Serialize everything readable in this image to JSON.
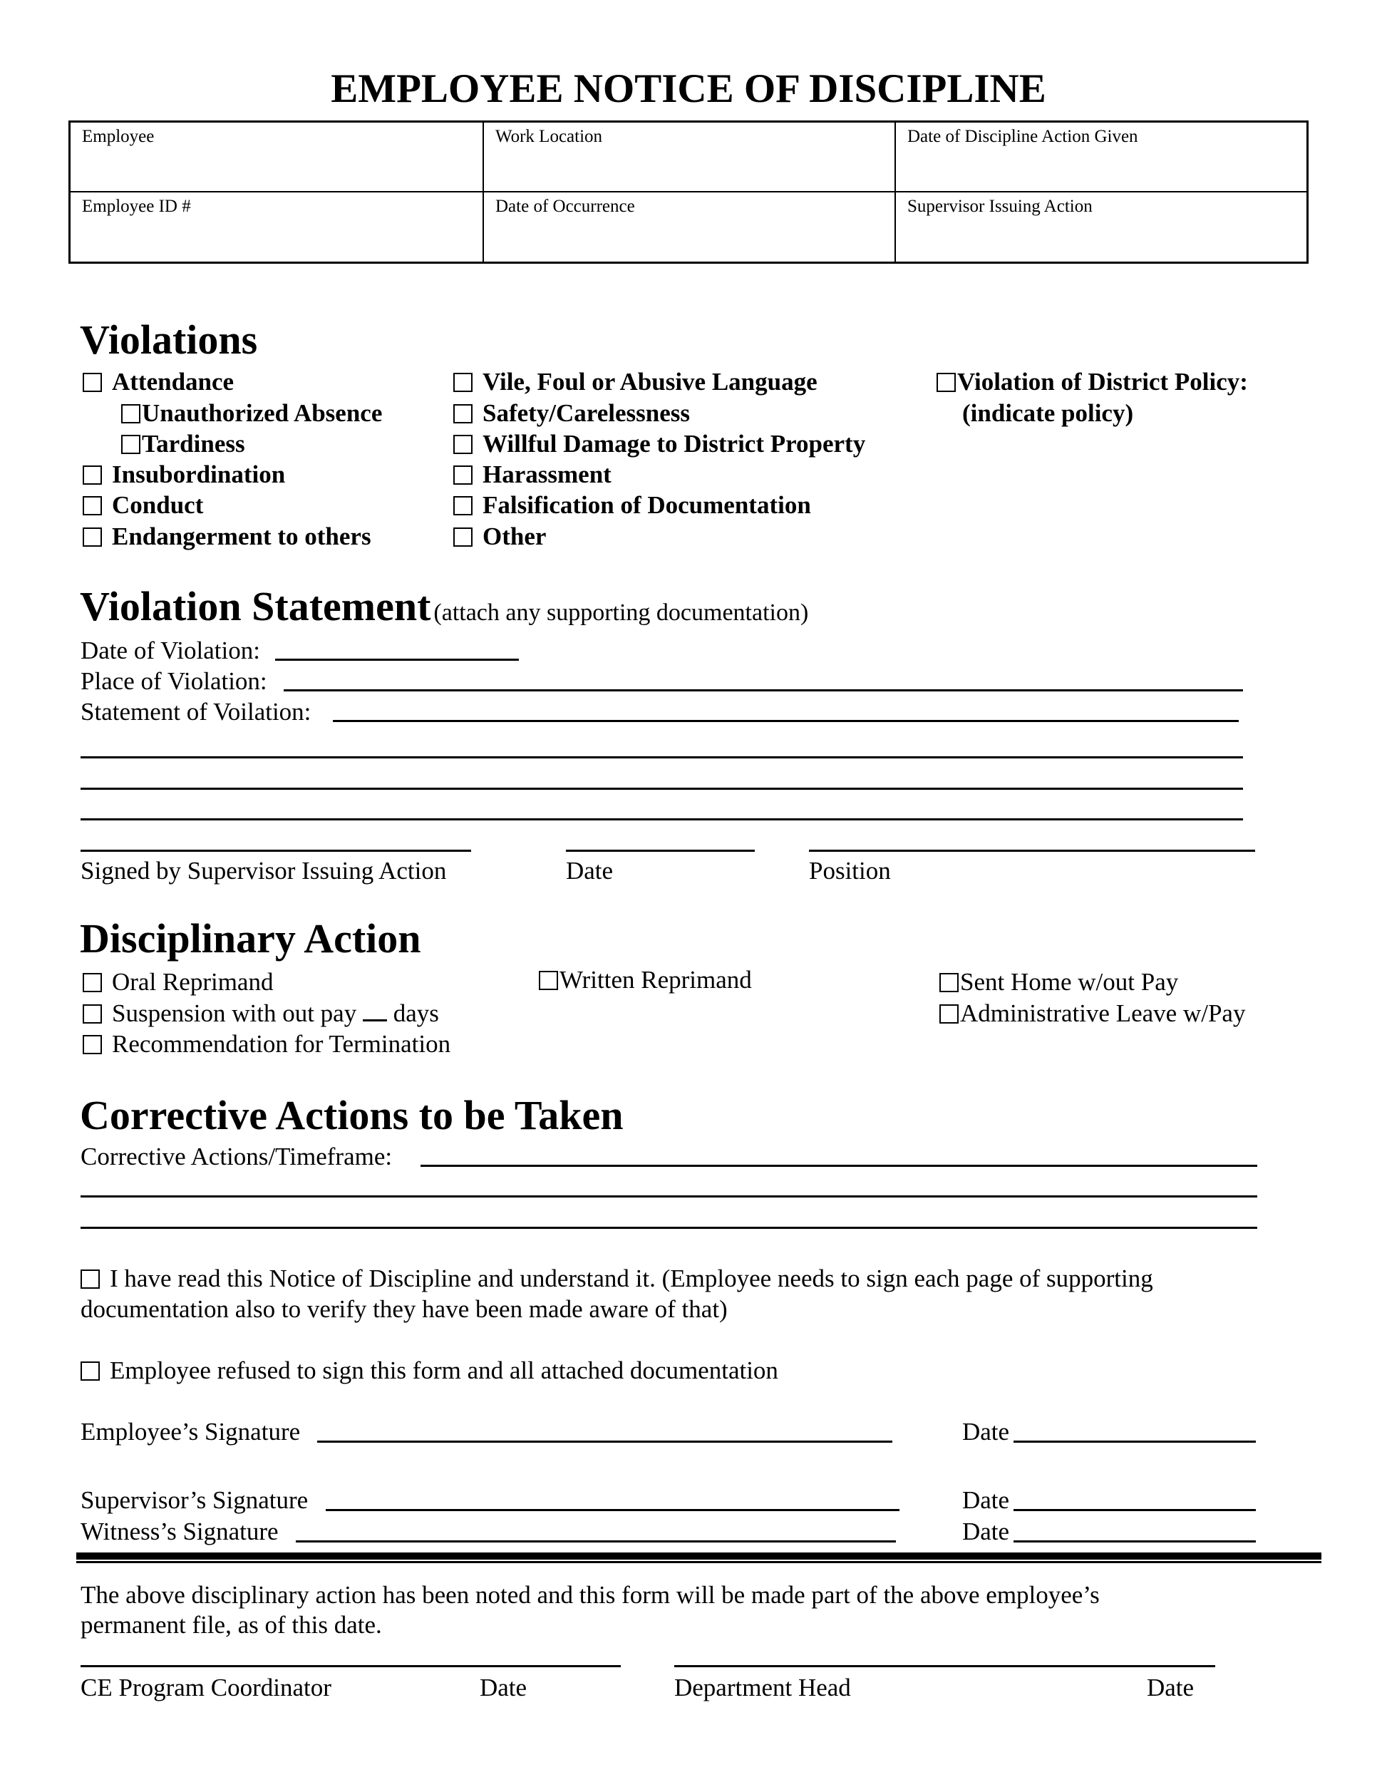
{
  "title": "EMPLOYEE NOTICE OF DISCIPLINE",
  "header_table": {
    "row1": [
      "Employee",
      "Work Location",
      "Date of Discipline Action Given"
    ],
    "row2": [
      "Employee ID #",
      "Date of Occurrence",
      "Supervisor Issuing Action"
    ]
  },
  "violations": {
    "heading": "Violations",
    "col1": [
      "Attendance",
      "Unauthorized Absence",
      "Tardiness",
      "Insubordination",
      "Conduct",
      "Endangerment to others"
    ],
    "col2": [
      "Vile, Foul or Abusive Language",
      "Safety/Carelessness",
      "Willful Damage to District Property",
      "Harassment",
      "Falsification of Documentation",
      "Other"
    ],
    "col3": [
      "Violation of District Policy:",
      "(indicate policy)"
    ]
  },
  "violation_statement": {
    "heading": "Violation Statement",
    "note": "(attach any supporting documentation)",
    "date_label": "Date of Violation:",
    "place_label": "Place of Violation:",
    "statement_label": "Statement of Voilation:",
    "sig_labels": [
      "Signed by Supervisor Issuing Action",
      "Date",
      "Position"
    ]
  },
  "disciplinary_action": {
    "heading": "Disciplinary Action",
    "col1": [
      "Oral Reprimand",
      "Suspension with out pay",
      "Recommendation for Termination"
    ],
    "suspension_suffix": "days",
    "col2": [
      "Written Reprimand"
    ],
    "col3": [
      "Sent Home w/out Pay",
      "Administrative Leave w/Pay"
    ]
  },
  "corrective": {
    "heading": "Corrective Actions to be Taken",
    "timeframe_label": "Corrective Actions/Timeframe:"
  },
  "acknowledgement": {
    "read_line1": "I have read this Notice of Discipline and understand it. (Employee needs to sign each page of supporting",
    "read_line2": "documentation also to verify they have been made aware of that)",
    "refused": "Employee refused to sign this form and all attached documentation"
  },
  "signatures": {
    "employee": "Employee’s Signature",
    "supervisor": "Supervisor’s Signature",
    "witness": "Witness’s Signature",
    "date": "Date"
  },
  "footer": {
    "text_line1": "The above disciplinary action has been noted and this form will be made part of the above employee’s",
    "text_line2": "permanent file, as of this date.",
    "labels": [
      "CE Program Coordinator",
      "Date",
      "Department Head",
      "Date"
    ]
  }
}
